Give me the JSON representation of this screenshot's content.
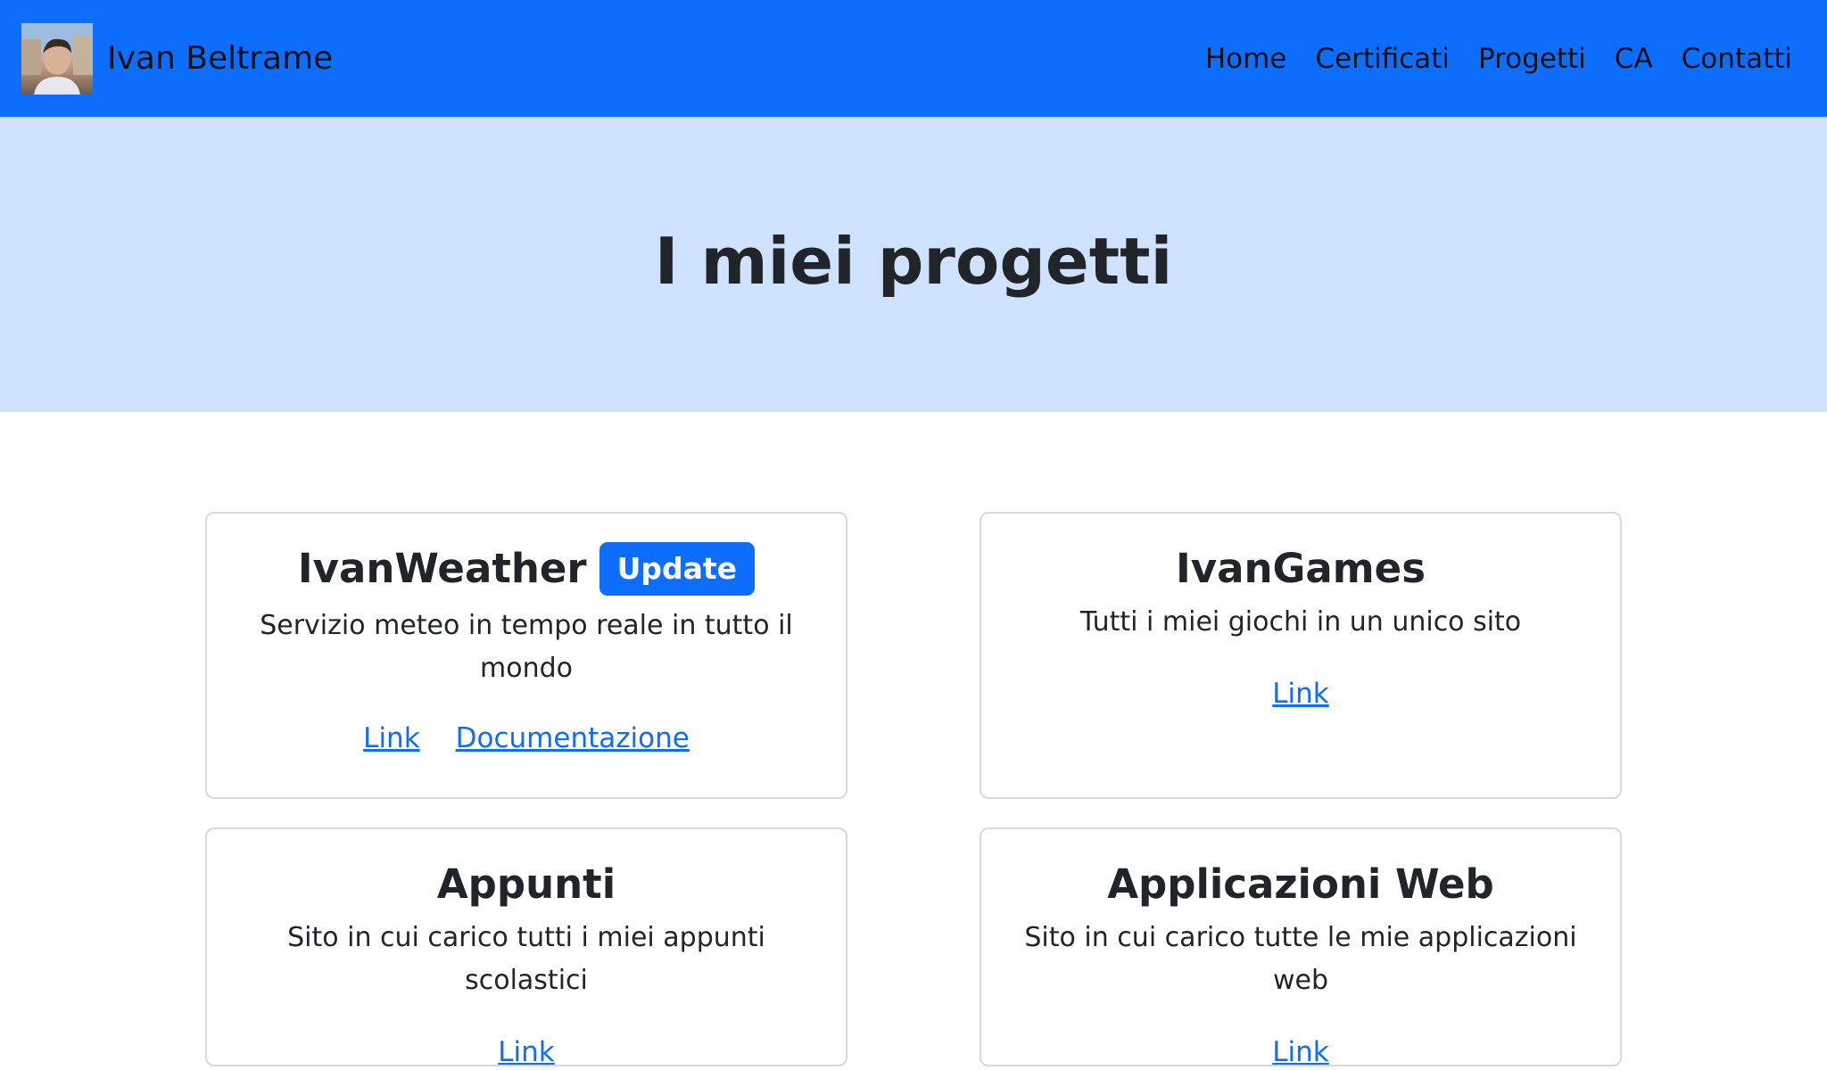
{
  "navbar": {
    "brand_name": "Ivan Beltrame",
    "bg_color": "#0d6efd",
    "links": [
      {
        "label": "Home"
      },
      {
        "label": "Certificati"
      },
      {
        "label": "Progetti"
      },
      {
        "label": "CA"
      },
      {
        "label": "Contatti"
      }
    ]
  },
  "hero": {
    "title": "I miei progetti",
    "bg_color": "#cfe2ff"
  },
  "projects": [
    {
      "title": "IvanWeather",
      "badge": "Update",
      "description": "Servizio meteo in tempo reale in tutto il mondo",
      "links": [
        {
          "label": "Link"
        },
        {
          "label": "Documentazione"
        }
      ]
    },
    {
      "title": "IvanGames",
      "description": "Tutti i miei giochi in un unico sito",
      "links": [
        {
          "label": "Link"
        }
      ]
    },
    {
      "title": "Appunti",
      "description": "Sito in cui carico tutti i miei appunti scolastici",
      "links": [
        {
          "label": "Link"
        }
      ]
    },
    {
      "title": "Applicazioni Web",
      "description": "Sito in cui carico tutte le mie applicazioni web",
      "links": [
        {
          "label": "Link"
        }
      ]
    }
  ],
  "colors": {
    "accent": "#0d6efd",
    "link": "#0d6efd",
    "text": "#212529"
  }
}
